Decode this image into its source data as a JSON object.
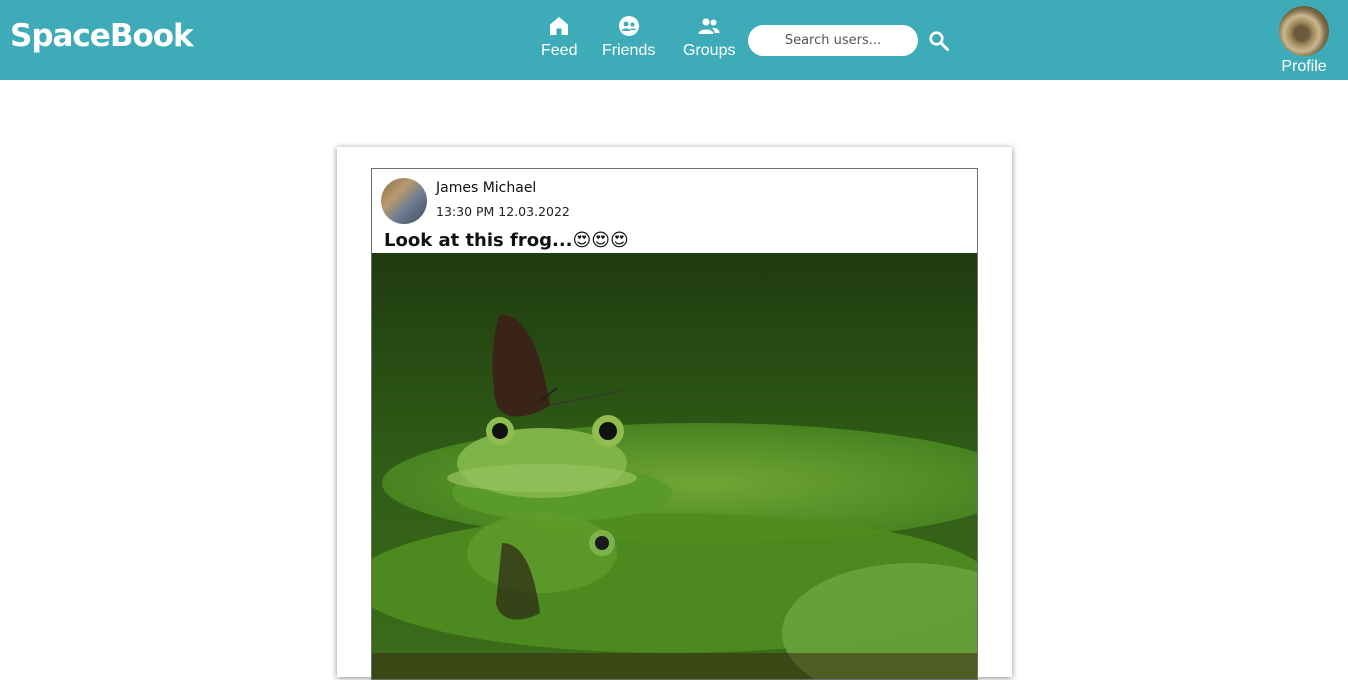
{
  "app": {
    "logo": "SpaceBook"
  },
  "nav": {
    "feed": {
      "label": "Feed",
      "icon": "home-icon"
    },
    "friends": {
      "label": "Friends",
      "icon": "friends-icon"
    },
    "groups": {
      "label": "Groups",
      "icon": "groups-icon"
    }
  },
  "search": {
    "placeholder": "Search users...",
    "value": ""
  },
  "profile": {
    "label": "Profile"
  },
  "post": {
    "author": "James Michael",
    "timestamp": "13:30 PM 12.03.2022",
    "text": "Look at this frog...😍😍😍"
  },
  "colors": {
    "topbar": "#3eabb8",
    "background": "#ffffff"
  }
}
